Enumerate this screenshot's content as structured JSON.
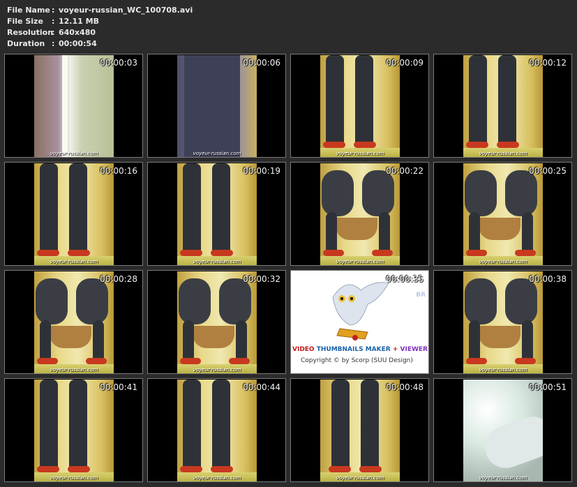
{
  "info": {
    "file_name_label": "File Name",
    "file_name": "voyeur-russian_WC_100708.avi",
    "file_size_label": "File Size",
    "file_size": "12.11 MB",
    "resolution_label": "Resolution",
    "resolution": "640x480",
    "duration_label": "Duration",
    "duration": "00:00:54",
    "colon": ":"
  },
  "watermark": "voyeur-russian.com",
  "thumbnails": [
    {
      "time": "00:00:03",
      "scene": "door"
    },
    {
      "time": "00:00:06",
      "scene": "closeup"
    },
    {
      "time": "00:00:09",
      "scene": "standing"
    },
    {
      "time": "00:00:12",
      "scene": "standing"
    },
    {
      "time": "00:00:16",
      "scene": "standing"
    },
    {
      "time": "00:00:19",
      "scene": "standing"
    },
    {
      "time": "00:00:22",
      "scene": "squat"
    },
    {
      "time": "00:00:25",
      "scene": "squat"
    },
    {
      "time": "00:00:28",
      "scene": "squat"
    },
    {
      "time": "00:00:32",
      "scene": "squat"
    },
    {
      "time": "00:00:35",
      "scene": "logo"
    },
    {
      "time": "00:00:38",
      "scene": "squat"
    },
    {
      "time": "00:00:41",
      "scene": "standing"
    },
    {
      "time": "00:00:44",
      "scene": "standing"
    },
    {
      "time": "00:00:48",
      "scene": "walking"
    },
    {
      "time": "00:00:51",
      "scene": "blur"
    }
  ],
  "logo": {
    "brand_part1": "VIDEO",
    "brand_part2": "THUMBNAILS MAKER",
    "brand_plus": "+",
    "brand_part3": "VIEWER",
    "copyright": "Copyright © by Scorp (SUU Design)",
    "corner": "BR"
  }
}
